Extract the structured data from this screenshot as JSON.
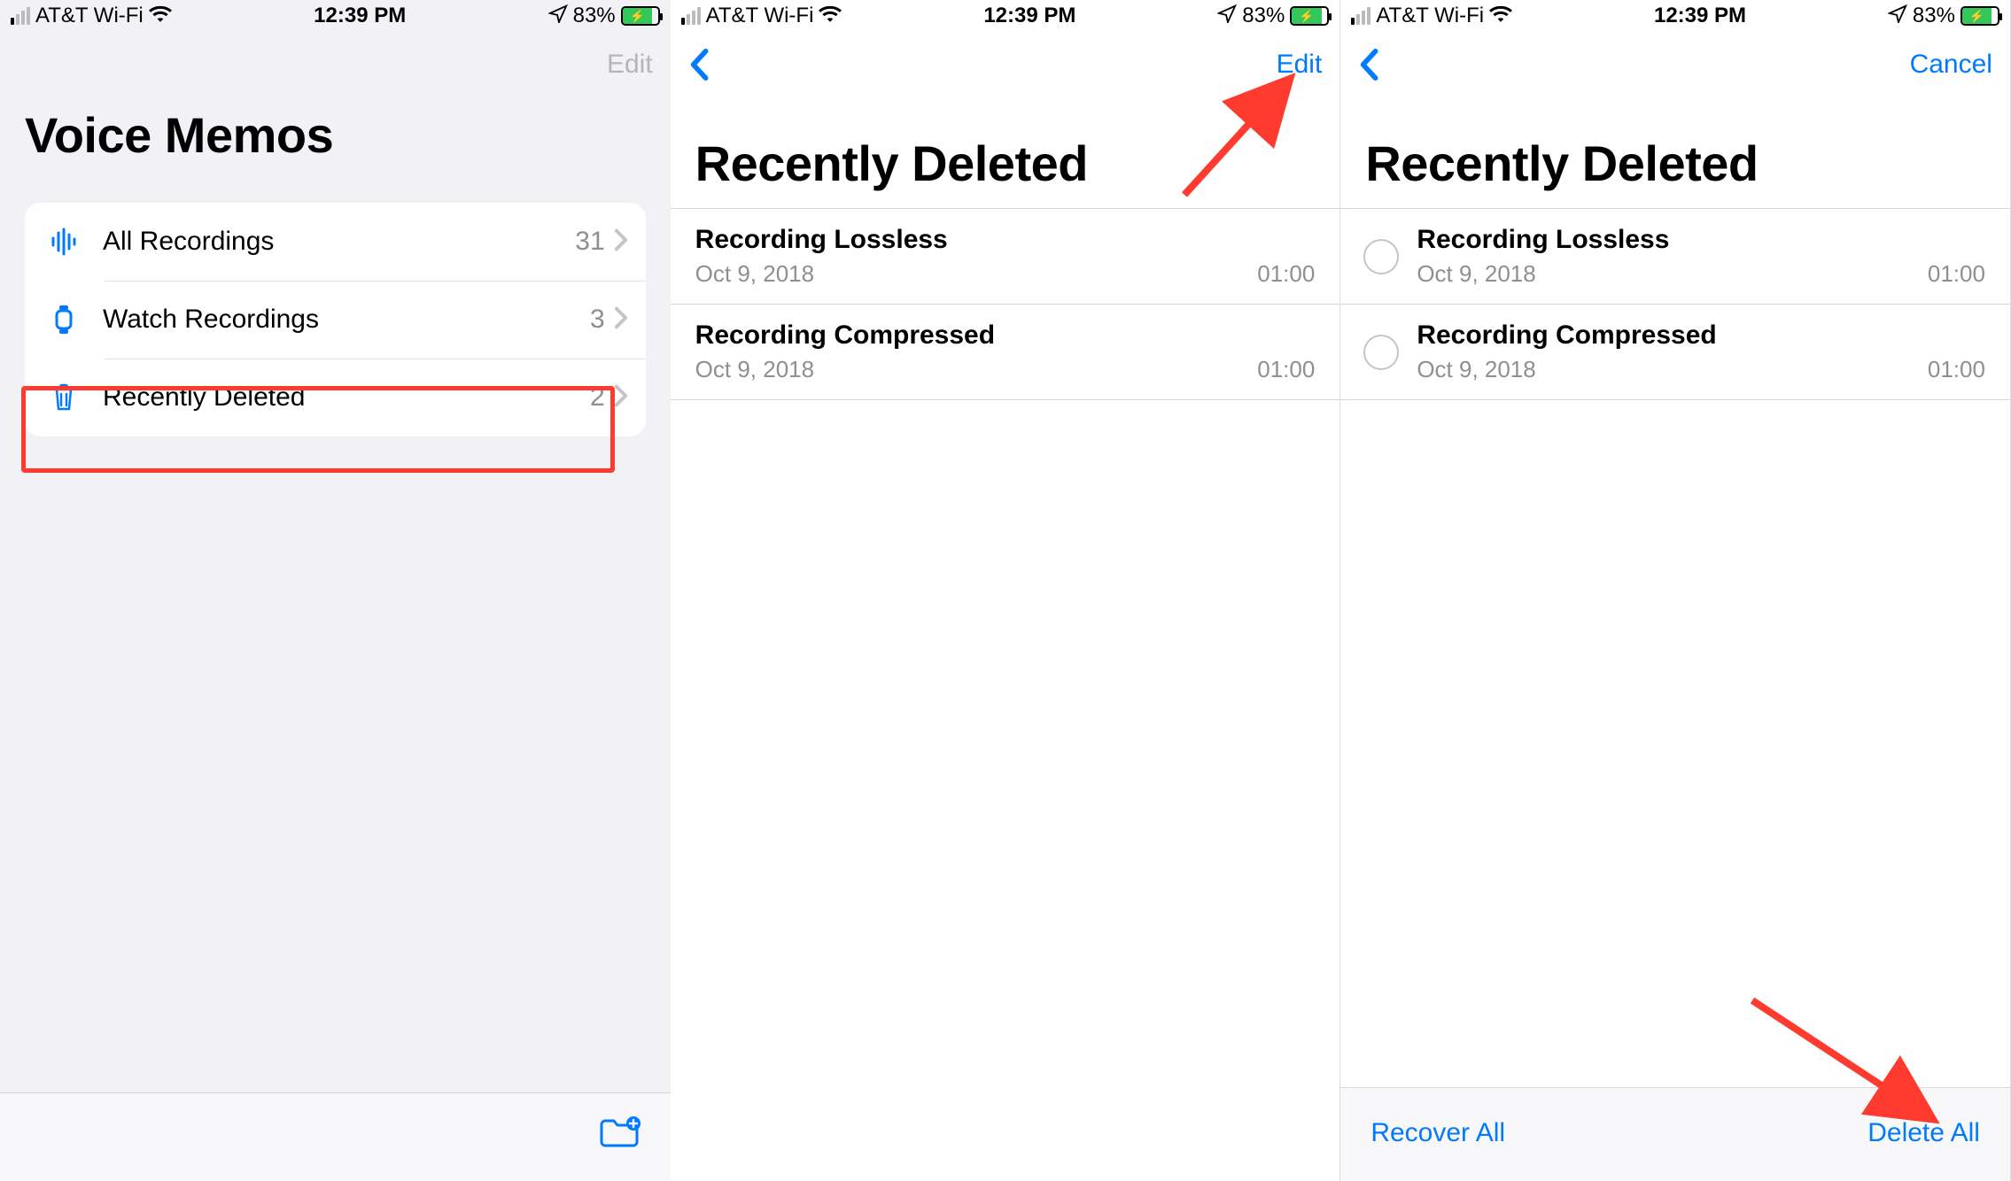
{
  "status": {
    "carrier": "AT&T Wi-Fi",
    "time": "12:39 PM",
    "battery_pct": "83%"
  },
  "pane1": {
    "edit_label": "Edit",
    "title": "Voice Memos",
    "folders": [
      {
        "label": "All Recordings",
        "count": "31"
      },
      {
        "label": "Watch Recordings",
        "count": "3"
      },
      {
        "label": "Recently Deleted",
        "count": "2"
      }
    ]
  },
  "pane2": {
    "edit_label": "Edit",
    "title": "Recently Deleted",
    "recordings": [
      {
        "title": "Recording Lossless",
        "date": "Oct 9, 2018",
        "duration": "01:00"
      },
      {
        "title": "Recording Compressed",
        "date": "Oct 9, 2018",
        "duration": "01:00"
      }
    ]
  },
  "pane3": {
    "cancel_label": "Cancel",
    "title": "Recently Deleted",
    "recordings": [
      {
        "title": "Recording Lossless",
        "date": "Oct 9, 2018",
        "duration": "01:00"
      },
      {
        "title": "Recording Compressed",
        "date": "Oct 9, 2018",
        "duration": "01:00"
      }
    ],
    "recover_label": "Recover All",
    "delete_label": "Delete All"
  }
}
